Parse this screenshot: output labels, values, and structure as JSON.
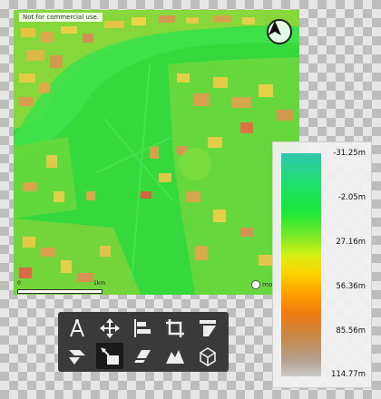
{
  "map": {
    "notice": "Not for commercial use.",
    "scale": {
      "start_label": "0",
      "end_label": "1km"
    },
    "attribution": "mo",
    "icons": {
      "compass": "north-arrow-icon",
      "attribution": "provider-logo-icon"
    }
  },
  "legend": {
    "labels": [
      "-31.25m",
      "-2.05m",
      "27.16m",
      "56.36m",
      "85.56m",
      "114.77m"
    ],
    "colors": [
      "#30c6b0",
      "#1ee06a",
      "#d7ef12",
      "#ff9a00",
      "#c9874a",
      "#c8c8c8"
    ]
  },
  "toolbar": {
    "tools": [
      {
        "name": "measure-tool",
        "icon": "compass-measure-icon"
      },
      {
        "name": "move-tool",
        "icon": "move-arrows-icon"
      },
      {
        "name": "align-tool",
        "icon": "align-left-icon"
      },
      {
        "name": "crop-tool",
        "icon": "crop-icon"
      },
      {
        "name": "slope-tool",
        "icon": "slope-icon"
      },
      {
        "name": "flip-tool",
        "icon": "flip-icon"
      },
      {
        "name": "select-area-tool",
        "icon": "select-area-icon",
        "active": true
      },
      {
        "name": "path-tool",
        "icon": "path-arrow-icon"
      },
      {
        "name": "terrain-tool",
        "icon": "terrain-icon"
      },
      {
        "name": "cube-tool",
        "icon": "cube-icon"
      }
    ]
  }
}
